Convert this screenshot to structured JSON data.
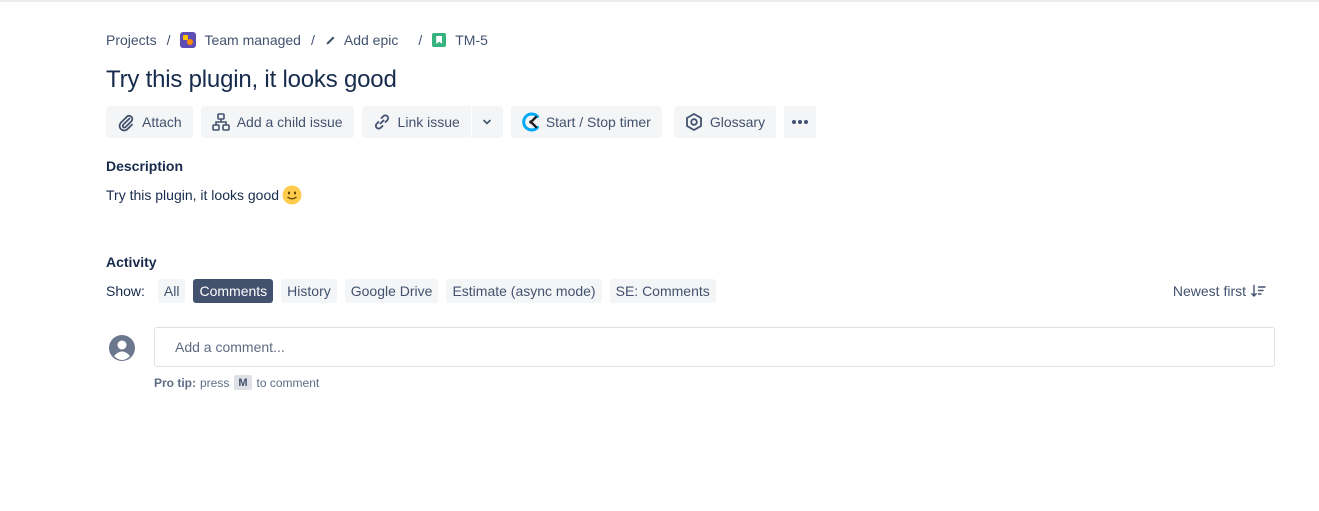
{
  "breadcrumb": {
    "projects": "Projects",
    "separator": "/",
    "project_name": "Team managed",
    "project_icon": "project-avatar-icon",
    "add_epic": "Add epic",
    "add_epic_icon": "pencil-icon",
    "issue_key": "TM-5",
    "issue_icon": "story-icon"
  },
  "issue": {
    "title": "Try this plugin, it looks good"
  },
  "toolbar": {
    "attach_label": "Attach",
    "attach_icon": "paperclip-icon",
    "child_label": "Add a child issue",
    "child_icon": "hierarchy-icon",
    "link_label": "Link issue",
    "link_icon": "link-icon",
    "link_dropdown_icon": "chevron-down-icon",
    "timer_label": "Start / Stop timer",
    "timer_icon": "clockify-icon",
    "glossary_label": "Glossary",
    "glossary_icon": "hexagon-icon",
    "more_icon": "more-icon"
  },
  "description": {
    "heading": "Description",
    "text": "Try this plugin, it looks good",
    "emoji": "slightly-smiling-face-icon"
  },
  "activity": {
    "heading": "Activity",
    "show_label": "Show:",
    "filters": [
      {
        "label": "All",
        "active": false
      },
      {
        "label": "Comments",
        "active": true
      },
      {
        "label": "History",
        "active": false
      },
      {
        "label": "Google Drive",
        "active": false
      },
      {
        "label": "Estimate (async mode)",
        "active": false
      },
      {
        "label": "SE: Comments",
        "active": false
      }
    ],
    "sort_label": "Newest first",
    "sort_icon": "sort-descending-icon",
    "comment_placeholder": "Add a comment...",
    "protip_label": "Pro tip:",
    "protip_pre": "press",
    "protip_key": "M",
    "protip_post": "to comment"
  },
  "colors": {
    "text": "#172b4d",
    "subtle": "#42526e",
    "button_bg": "#f4f5f7",
    "active_filter_bg": "#42526e",
    "story_green": "#36b37e",
    "timer_blue": "#03a9f4"
  }
}
